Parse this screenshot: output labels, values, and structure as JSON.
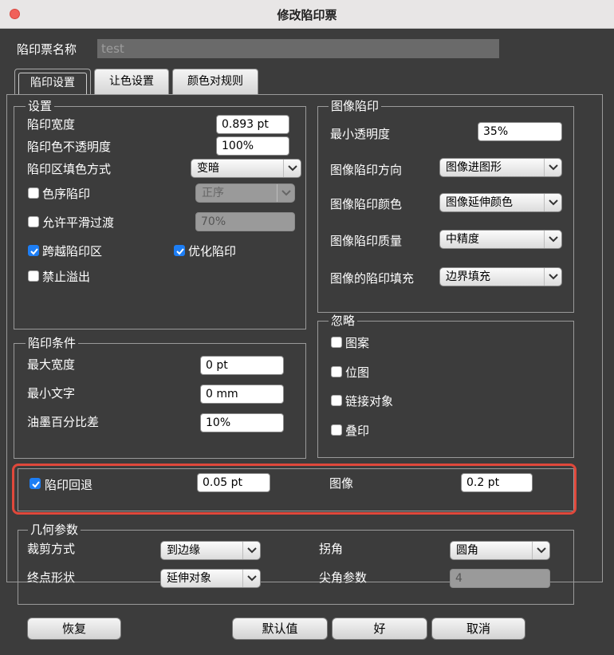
{
  "window": {
    "title": "修改陷印票"
  },
  "name_row": {
    "label": "陷印票名称",
    "value": "test"
  },
  "tabs": [
    {
      "label": "陷印设置",
      "active": true
    },
    {
      "label": "让色设置",
      "active": false
    },
    {
      "label": "颜色对规则",
      "active": false
    }
  ],
  "settings": {
    "title": "设置",
    "trap_width_label": "陷印宽度",
    "trap_width_value": "0.893 pt",
    "trap_opacity_label": "陷印色不透明度",
    "trap_opacity_value": "100%",
    "fill_mode_label": "陷印区填色方式",
    "fill_mode_value": "变暗",
    "sequence_trap_label": "色序陷印",
    "sequence_value": "正序",
    "smooth_label": "允许平滑过渡",
    "smooth_value": "70%",
    "cross_trap_label": "跨越陷印区",
    "optimize_label": "优化陷印",
    "no_overflow_label": "禁止溢出"
  },
  "image_trap": {
    "title": "图像陷印",
    "min_opacity_label": "最小透明度",
    "min_opacity_value": "35%",
    "direction_label": "图像陷印方向",
    "direction_value": "图像进图形",
    "color_label": "图像陷印颜色",
    "color_value": "图像延伸颜色",
    "quality_label": "图像陷印质量",
    "quality_value": "中精度",
    "fill_label": "图像的陷印填充",
    "fill_value": "边界填充"
  },
  "trap_conditions": {
    "title": "陷印条件",
    "max_width_label": "最大宽度",
    "max_width_value": "0 pt",
    "min_text_label": "最小文字",
    "min_text_value": "0 mm",
    "ink_diff_label": "油墨百分比差",
    "ink_diff_value": "10%"
  },
  "ignore": {
    "title": "忽略",
    "pattern_label": "图案",
    "bitmap_label": "位图",
    "link_label": "链接对象",
    "overprint_label": "叠印"
  },
  "pullback": {
    "label": "陷印回退",
    "value": "0.05 pt",
    "image_label": "图像",
    "image_value": "0.2 pt"
  },
  "geometry": {
    "title": "几何参数",
    "clip_label": "裁剪方式",
    "clip_value": "到边缘",
    "corner_label": "拐角",
    "corner_value": "圆角",
    "endpoint_label": "终点形状",
    "endpoint_value": "延伸对象",
    "miter_label": "尖角参数",
    "miter_value": "4"
  },
  "buttons": {
    "restore": "恢复",
    "default": "默认值",
    "ok": "好",
    "cancel": "取消"
  },
  "colors": {
    "accent": "#1d7ef5",
    "highlight": "#e0483b",
    "background": "#3c3c3c"
  }
}
